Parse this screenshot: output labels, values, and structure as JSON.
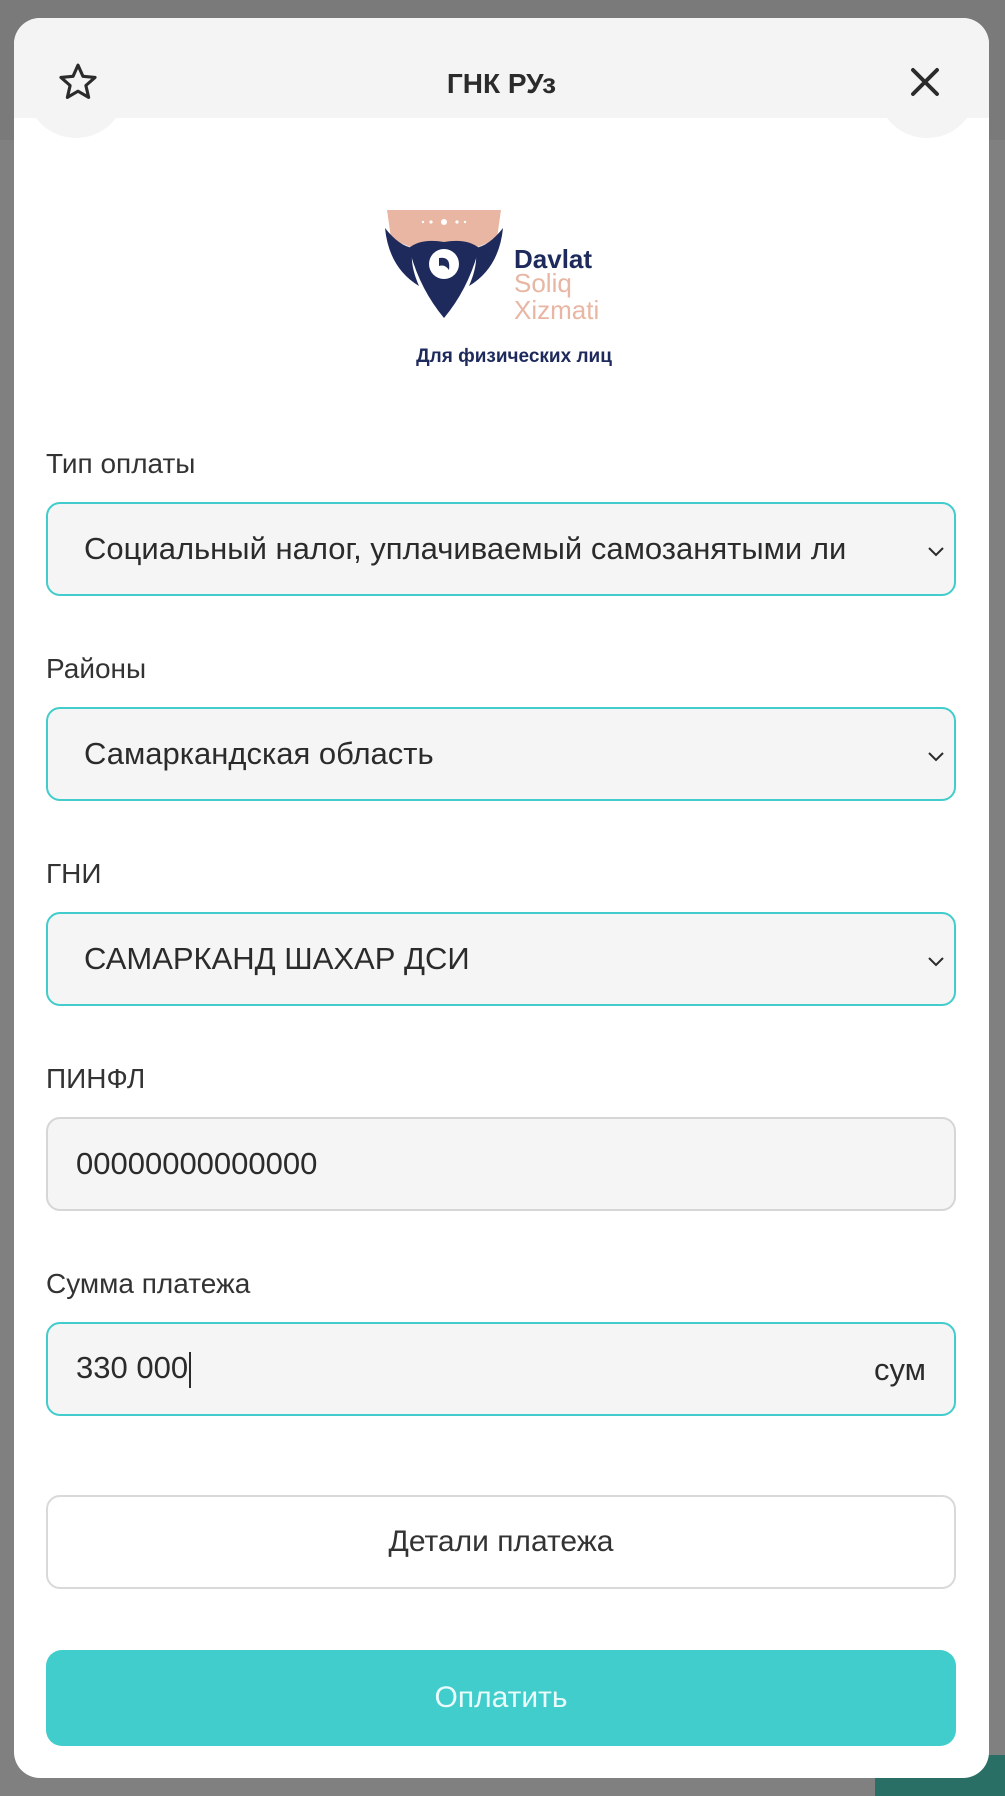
{
  "header": {
    "title": "ГНК РУз"
  },
  "logo": {
    "line1": "Davlat",
    "line2": "Soliq",
    "line3": "Xizmati",
    "subtitle": "Для физических лиц"
  },
  "form": {
    "payment_type": {
      "label": "Тип оплаты",
      "value": "Социальный налог, уплачиваемый самозанятыми ли"
    },
    "district": {
      "label": "Районы",
      "value": "Самаркандская область"
    },
    "gni": {
      "label": "ГНИ",
      "value": "САМАРКАНД ШАХАР ДСИ"
    },
    "pinfl": {
      "label": "ПИНФЛ",
      "value": "00000000000000"
    },
    "amount": {
      "label": "Сумма платежа",
      "value": "330 000",
      "unit": "сум"
    }
  },
  "buttons": {
    "details": "Детали платежа",
    "pay": "Оплатить"
  },
  "colors": {
    "accent": "#41cdcc",
    "brand_navy": "#1d2a5b",
    "brand_peach": "#e8b6a2"
  },
  "icons": {
    "favorite": "star-icon",
    "close": "close-icon",
    "dropdown": "chevron-down-icon"
  }
}
